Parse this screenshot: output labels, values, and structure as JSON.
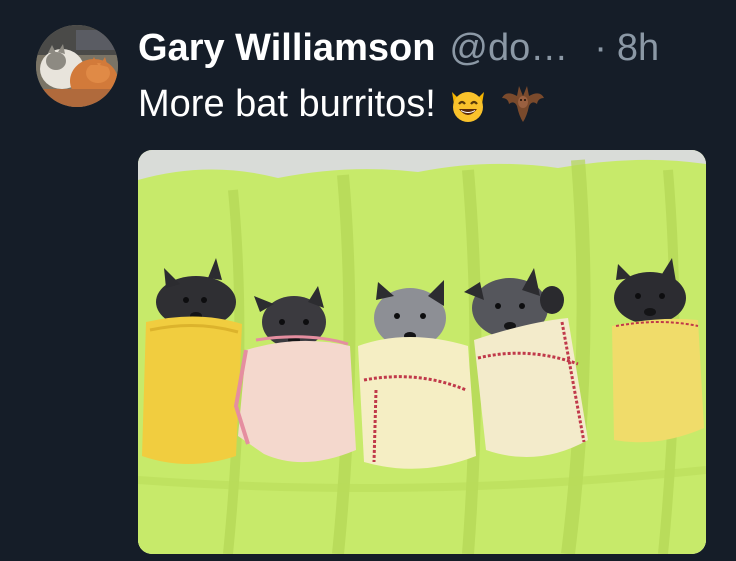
{
  "tweet": {
    "author": {
      "display_name": "Gary Williamson",
      "handle": "@do…",
      "avatar_icon": "cat-photo-avatar"
    },
    "separator": "·",
    "timestamp": "8h",
    "text": "More bat burritos!",
    "emojis": [
      "smiling-cat-face-icon",
      "bat-icon"
    ],
    "media": {
      "description_icon": "photo-bats-wrapped-in-blankets",
      "blanket_colors": [
        "#f3d24a",
        "#f3d6cf",
        "#f4edc8",
        "#f1e9c9",
        "#f0dc6a"
      ]
    }
  },
  "colors": {
    "background": "#151d28",
    "text_primary": "#ffffff",
    "text_secondary": "#8b98a5",
    "towel_green": "#c6e86a"
  }
}
